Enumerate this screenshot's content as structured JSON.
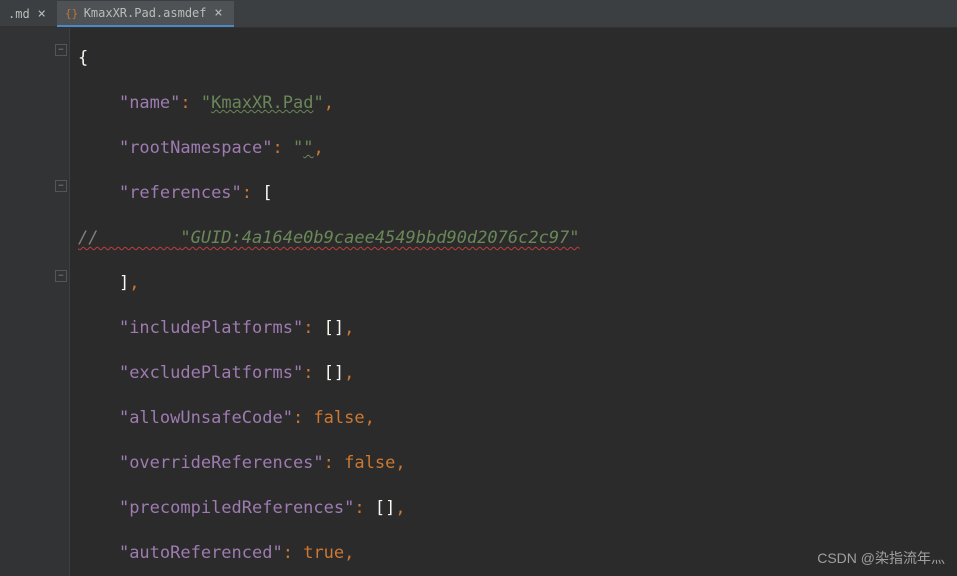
{
  "tabs": {
    "inactive": {
      "label": ".md"
    },
    "active": {
      "label": "KmaxXR.Pad.asmdef"
    }
  },
  "code": {
    "open_brace": "{",
    "name_key": "\"name\"",
    "name_value_q1": "\"",
    "name_value": "KmaxXR.Pad",
    "name_value_q2": "\"",
    "root_ns_key": "\"rootNamespace\"",
    "root_ns_value_q1": "\"",
    "root_ns_value": "",
    "root_ns_value_q2": "\"",
    "references_key": "\"references\"",
    "references_open": "[",
    "comment_prefix": "//        ",
    "comment_value": "\"GUID:4a164e0b9caee4549bbd90d2076c2c97\"",
    "references_close": "]",
    "include_platforms_key": "\"includePlatforms\"",
    "include_platforms_value": "[]",
    "exclude_platforms_key": "\"excludePlatforms\"",
    "exclude_platforms_value": "[]",
    "allow_unsafe_key": "\"allowUnsafeCode\"",
    "allow_unsafe_value": "false",
    "override_refs_key": "\"overrideReferences\"",
    "override_refs_value": "false",
    "precompiled_refs_key": "\"precompiledReferences\"",
    "precompiled_refs_value": "[]",
    "auto_referenced_key": "\"autoReferenced\"",
    "auto_referenced_value": "true",
    "colon": ": ",
    "comma": ","
  },
  "watermark": "CSDN @染指流年灬"
}
